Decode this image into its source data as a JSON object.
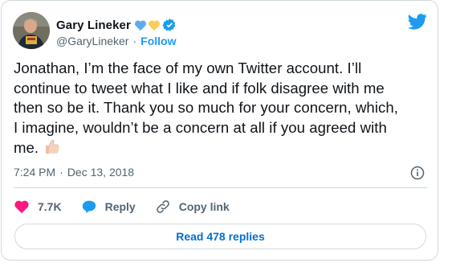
{
  "author": {
    "name": "Gary Lineker",
    "handle": "@GaryLineker",
    "follow_label": "Follow",
    "separator": "·"
  },
  "tweet": {
    "lines": [
      "Jonathan, I’m the face of my own Twitter account. I’ll",
      "continue to tweet what I like and if folk disagree with me",
      "then so be it. Thank you so much for your concern, which,",
      "I imagine, wouldn’t be a concern at all if you agreed with",
      "me."
    ],
    "time": "7:24 PM",
    "date": "Dec 13, 2018",
    "separator": "·"
  },
  "actions": {
    "like_count": "7.7K",
    "reply_label": "Reply",
    "copy_label": "Copy link"
  },
  "read_replies_label": "Read 478 replies",
  "colors": {
    "accent": "#1d9bf0",
    "heart": "#f91880",
    "blue_heart": "#5dadec",
    "yellow_heart": "#fdcb58"
  },
  "icons": [
    "twitter-bird-icon",
    "blue-heart-icon",
    "yellow-heart-icon",
    "verified-badge-icon",
    "thumbs-up-emoji",
    "info-icon",
    "heart-icon",
    "reply-icon",
    "link-icon"
  ]
}
